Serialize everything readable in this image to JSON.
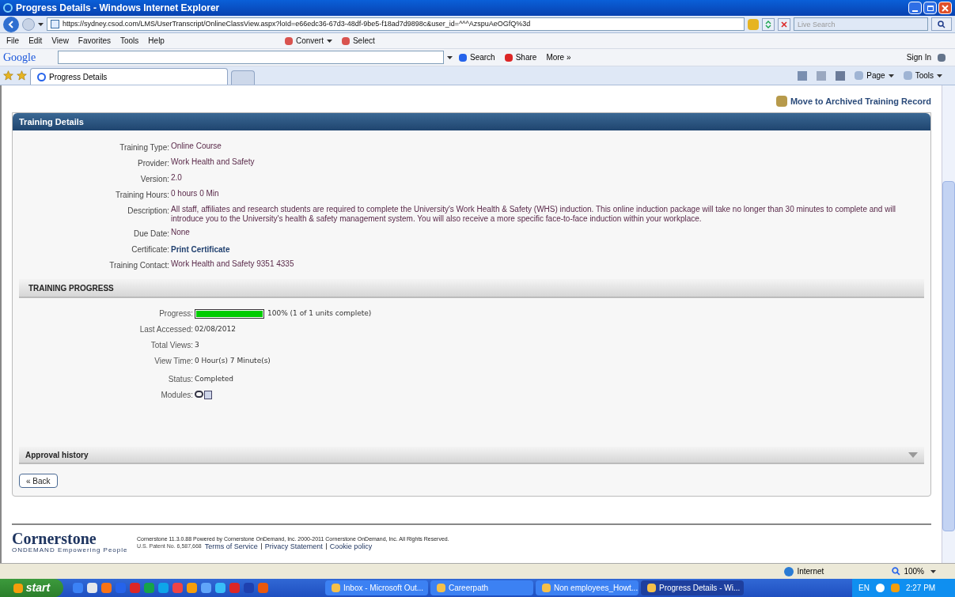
{
  "window": {
    "title": "Progress Details - Windows Internet Explorer"
  },
  "address_bar": {
    "url": "https://sydney.csod.com/LMS/UserTranscript/OnlineClassView.aspx?loId=e66edc36-67d3-48df-9be5-f18ad7d9898c&user_id=^^^AzspuAeOGfQ%3d",
    "search_placeholder": "Live Search"
  },
  "menu_bar": {
    "items": [
      "File",
      "Edit",
      "View",
      "Favorites",
      "Tools",
      "Help"
    ],
    "tools": [
      "Convert",
      "Select"
    ]
  },
  "google_toolbar": {
    "logo": "Google",
    "buttons": [
      "Search",
      "Share",
      "More »"
    ],
    "sign_in": "Sign In"
  },
  "tabs": [
    {
      "label": "Progress Details",
      "selected": true
    }
  ],
  "command_bar": [
    "Page",
    "Tools"
  ],
  "page": {
    "archive_link": "Move to Archived Training Record",
    "details": {
      "title": "Training Details",
      "fields": [
        {
          "label": "Training Type:",
          "value": "Online Course",
          "kind": "text"
        },
        {
          "label": "Provider:",
          "value": "Work Health and Safety",
          "kind": "text"
        },
        {
          "label": "Version:",
          "value": "2.0",
          "kind": "text"
        },
        {
          "label": "Training Hours:",
          "value": "0 hours 0 Min",
          "kind": "text"
        },
        {
          "label": "Description:",
          "value": "All staff, affiliates and research students are required to complete the University's Work Health & Safety (WHS) induction. This online induction package will take no longer than 30 minutes to complete and will introduce you to the University's health & safety management system. You will also receive a more specific face-to-face induction within your workplace.",
          "kind": "text"
        },
        {
          "label": "Due Date:",
          "value": "None",
          "kind": "text"
        },
        {
          "label": "Certificate:",
          "value": "Print Certificate",
          "kind": "link"
        },
        {
          "label": "Training Contact:",
          "value": "Work Health and Safety 9351 4335",
          "kind": "text"
        }
      ]
    },
    "progress": {
      "title": "TRAINING PROGRESS",
      "fields": [
        {
          "label": "Progress:",
          "kind": "bar",
          "level": 1,
          "value": "100% (1 of 1 units complete)"
        },
        {
          "label": "Last Accessed:",
          "kind": "text",
          "value": "02/08/2012"
        },
        {
          "label": "Total Views:",
          "kind": "text",
          "value": "3"
        },
        {
          "label": "View Time:",
          "kind": "text",
          "value": "0 Hour(s) 7 Minute(s)"
        },
        {
          "label": "Status:",
          "kind": "text",
          "value": "Completed"
        },
        {
          "label": "Modules:",
          "kind": "icons"
        }
      ]
    },
    "approval": {
      "title": "Approval history"
    },
    "back_button": "« Back",
    "footer": {
      "logo": "Cornerstone",
      "tagline": "ONDEMAND Empowering People",
      "copyright": "Cornerstone 11.3.0.88 Powered by Cornerstone OnDemand, Inc. 2000-2011 Cornerstone OnDemand, Inc. All Rights Reserved.",
      "patent": "U.S. Patent No. 6,587,668",
      "links": [
        "Terms of Service",
        "Privacy Statement",
        "Cookie policy"
      ]
    }
  },
  "status_bar": {
    "zone": "Internet",
    "zoom": "100%"
  },
  "taskbar": {
    "start": "start",
    "tasks": [
      {
        "label": "Inbox - Microsoft Out...",
        "selected": false
      },
      {
        "label": "Careerpath",
        "selected": false
      },
      {
        "label": "Non employees_Howt...",
        "selected": false
      },
      {
        "label": "Progress Details - Wi...",
        "selected": true
      }
    ],
    "language": "EN",
    "time": "2:27 PM"
  }
}
